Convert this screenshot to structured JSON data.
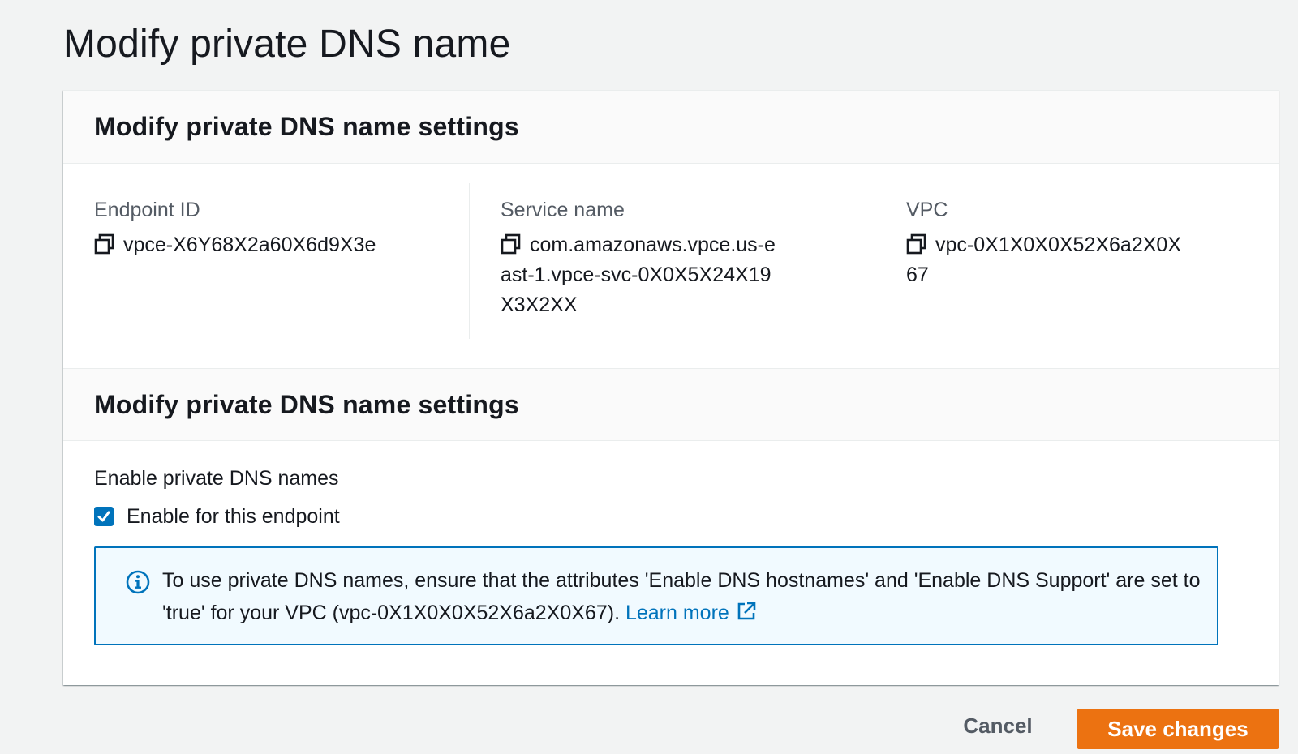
{
  "page": {
    "title": "Modify private DNS name"
  },
  "details_section": {
    "header": "Modify private DNS name settings",
    "fields": [
      {
        "label": "Endpoint ID",
        "value": "vpce-X6Y68X2a60X6d9X3e",
        "icon": "copy-icon"
      },
      {
        "label": "Service name",
        "value": "com.amazonaws.vpce.us-east-1.vpce-svc-0X0X5X24X19X3X2XX",
        "icon": "copy-icon"
      },
      {
        "label": "VPC",
        "value": "vpc-0X1X0X0X52X6a2X0X67",
        "icon": "copy-icon"
      }
    ]
  },
  "settings_section": {
    "header": "Modify private DNS name settings",
    "enable_label": "Enable private DNS names",
    "checkbox": {
      "label": "Enable for this endpoint",
      "checked": true
    },
    "info": {
      "icon": "info-icon",
      "text": "To use private DNS names, ensure that the attributes 'Enable DNS hostnames' and 'Enable DNS Support' are set to 'true' for your VPC (vpc-0X1X0X0X52X6a2X0X67).",
      "link_label": "Learn more",
      "link_icon": "external-link-icon"
    }
  },
  "actions": {
    "cancel_label": "Cancel",
    "save_label": "Save changes"
  },
  "colors": {
    "accent": "#0073bb",
    "primary_button": "#ec7211",
    "background": "#f2f3f3"
  }
}
